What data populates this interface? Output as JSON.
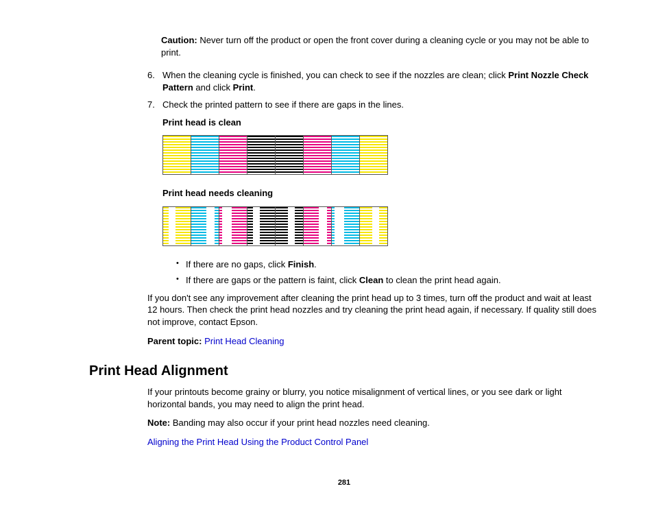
{
  "caution": {
    "label": "Caution:",
    "text": " Never turn off the product or open the front cover during a cleaning cycle or you may not be able to print."
  },
  "steps": {
    "s6": {
      "num": "6",
      "part1": "When the cleaning cycle is finished, you can check to see if the nozzles are clean; click ",
      "bold1": "Print Nozzle Check Pattern",
      "part2": " and click ",
      "bold2": "Print",
      "part3": "."
    },
    "s7": {
      "num": "7",
      "text": "Check the printed pattern to see if there are gaps in the lines.",
      "clean_label": "Print head is clean",
      "dirty_label": "Print head needs cleaning",
      "bullets": {
        "b1": {
          "pre": "If there are no gaps, click ",
          "bold": "Finish",
          "post": "."
        },
        "b2": {
          "pre": "If there are gaps or the pattern is faint, click ",
          "bold": "Clean",
          "post": " to clean the print head again."
        }
      }
    }
  },
  "after_steps": "If you don't see any improvement after cleaning the print head up to 3 times, turn off the product and wait at least 12 hours. Then check the print head nozzles and try cleaning the print head again, if necessary. If quality still does not improve, contact Epson.",
  "parent_topic": {
    "label": "Parent topic:",
    "link_text": "Print Head Cleaning"
  },
  "section2": {
    "heading": "Print Head Alignment",
    "intro": "If your printouts become grainy or blurry, you notice misalignment of vertical lines, or you see dark or light horizontal bands, you may need to align the print head.",
    "note_label": "Note:",
    "note_text": " Banding may also occur if your print head nozzles need cleaning.",
    "link": "Aligning the Print Head Using the Product Control Panel"
  },
  "page_number": "281"
}
